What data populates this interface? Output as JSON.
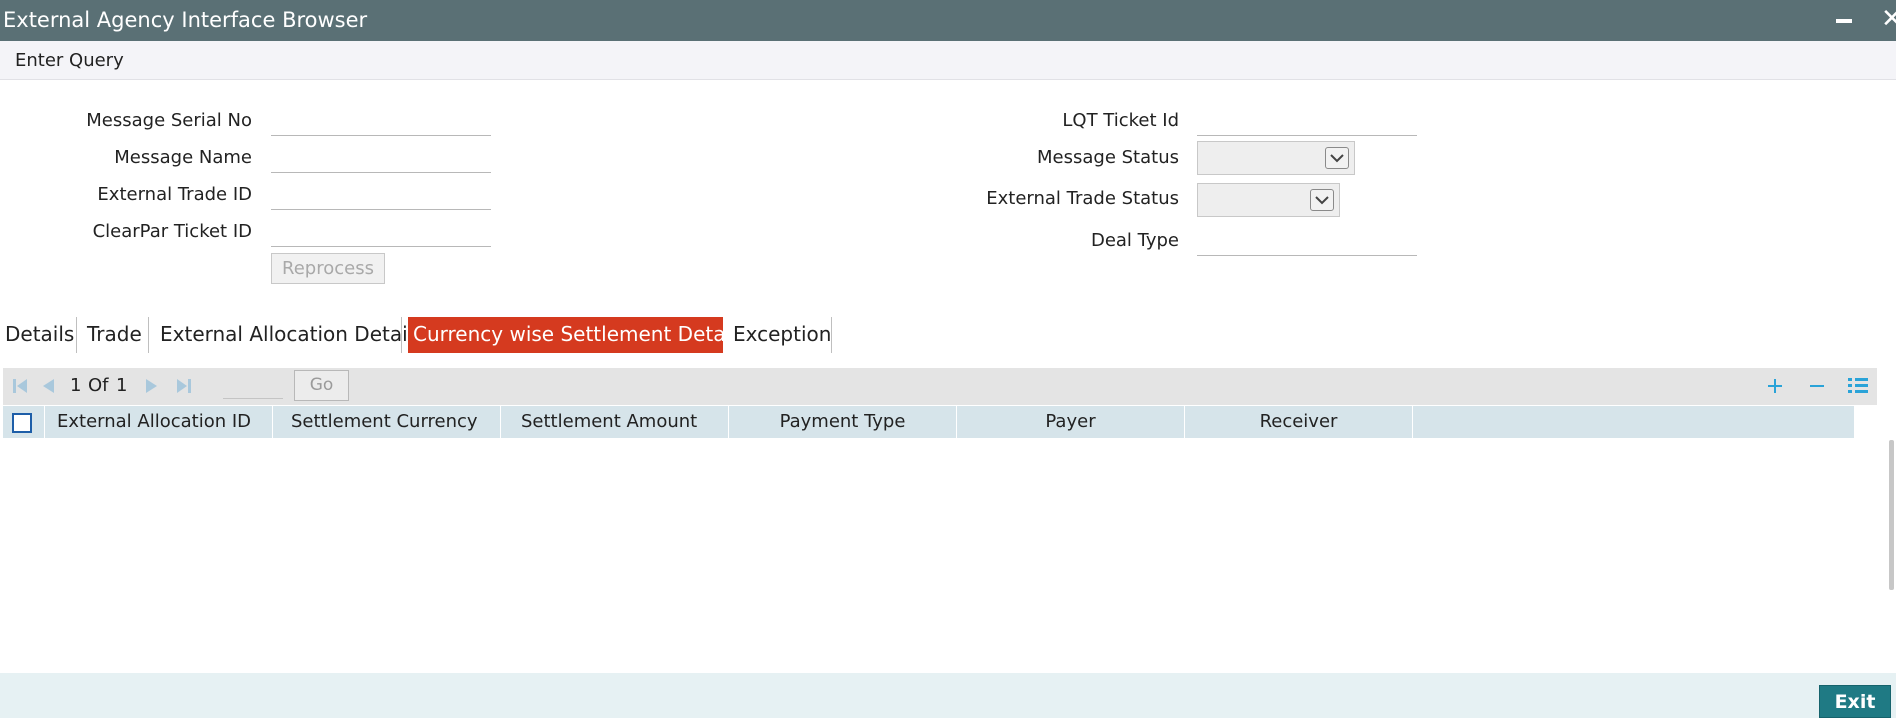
{
  "window": {
    "title": "External Agency Interface Browser"
  },
  "menu": {
    "enter_query": "Enter Query"
  },
  "form": {
    "message_serial_no_label": "Message Serial No",
    "message_name_label": "Message Name",
    "external_trade_id_label": "External Trade ID",
    "clearpar_ticket_id_label": "ClearPar Ticket ID",
    "lqt_ticket_id_label": "LQT Ticket Id",
    "message_status_label": "Message Status",
    "external_trade_status_label": "External Trade Status",
    "deal_type_label": "Deal Type",
    "reprocess_button": "Reprocess"
  },
  "tabs": [
    {
      "label": "Details"
    },
    {
      "label": "Trade"
    },
    {
      "label": "External Allocation Details"
    },
    {
      "label": "Currency wise Settlement Details",
      "active": true
    },
    {
      "label": "Exception"
    }
  ],
  "grid": {
    "pagination": {
      "current": "1",
      "of_label": "Of",
      "total": "1",
      "go_label": "Go"
    },
    "columns": [
      "External Allocation ID",
      "Settlement Currency",
      "Settlement Amount",
      "Payment Type",
      "Payer",
      "Receiver"
    ],
    "rows": []
  },
  "footer": {
    "exit_label": "Exit"
  },
  "colors": {
    "titlebar": "#5a7075",
    "active_tab": "#d53a1f",
    "grid_header": "#d6e4ea",
    "exit_button": "#1f7a84",
    "toolbar_icon": "#2aa3d8"
  }
}
